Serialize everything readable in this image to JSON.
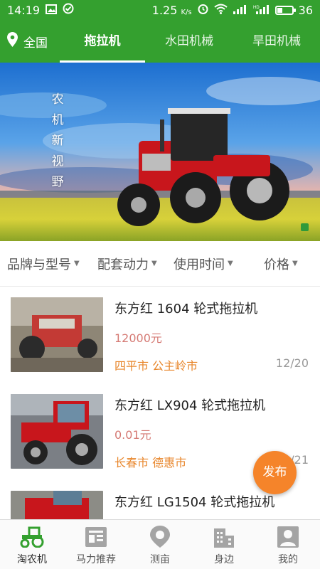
{
  "status_bar": {
    "time": "14:19",
    "network_speed": "1.25",
    "network_speed_unit": "K/s",
    "battery_level": "36",
    "battery_fraction": 0.36
  },
  "top_nav": {
    "location": "全国",
    "tabs": [
      {
        "label": "拖拉机",
        "active": true
      },
      {
        "label": "水田机械",
        "active": false
      },
      {
        "label": "旱田机械",
        "active": false
      }
    ]
  },
  "banner": {
    "slogan": [
      "农",
      "机",
      "新",
      "视",
      "野"
    ]
  },
  "filters": [
    {
      "label": "品牌与型号"
    },
    {
      "label": "配套动力"
    },
    {
      "label": "使用时间"
    },
    {
      "label": "价格"
    }
  ],
  "listings": [
    {
      "title": "东方红 1604 轮式拖拉机",
      "price": "12000元",
      "city": "四平市  公主岭市",
      "date": "12/20"
    },
    {
      "title": "东方红 LX904 轮式拖拉机",
      "price": "0.01元",
      "city": "长春市  德惠市",
      "date": "12/21"
    },
    {
      "title": "东方红 LG1504 轮式拖拉机",
      "price": "",
      "city": "",
      "date": ""
    }
  ],
  "fab_label": "发布",
  "bottom_tabs": [
    {
      "label": "淘农机",
      "icon": "tractor-icon",
      "active": true
    },
    {
      "label": "马力推荐",
      "icon": "horsepower-card-icon",
      "active": false
    },
    {
      "label": "测亩",
      "icon": "location-pin-icon",
      "active": false
    },
    {
      "label": "身边",
      "icon": "buildings-icon",
      "active": false
    },
    {
      "label": "我的",
      "icon": "profile-icon",
      "active": false
    }
  ],
  "colors": {
    "brand_green": "#34a02f",
    "price": "#d57a74",
    "city": "#e8862b",
    "fab": "#f5842a"
  }
}
